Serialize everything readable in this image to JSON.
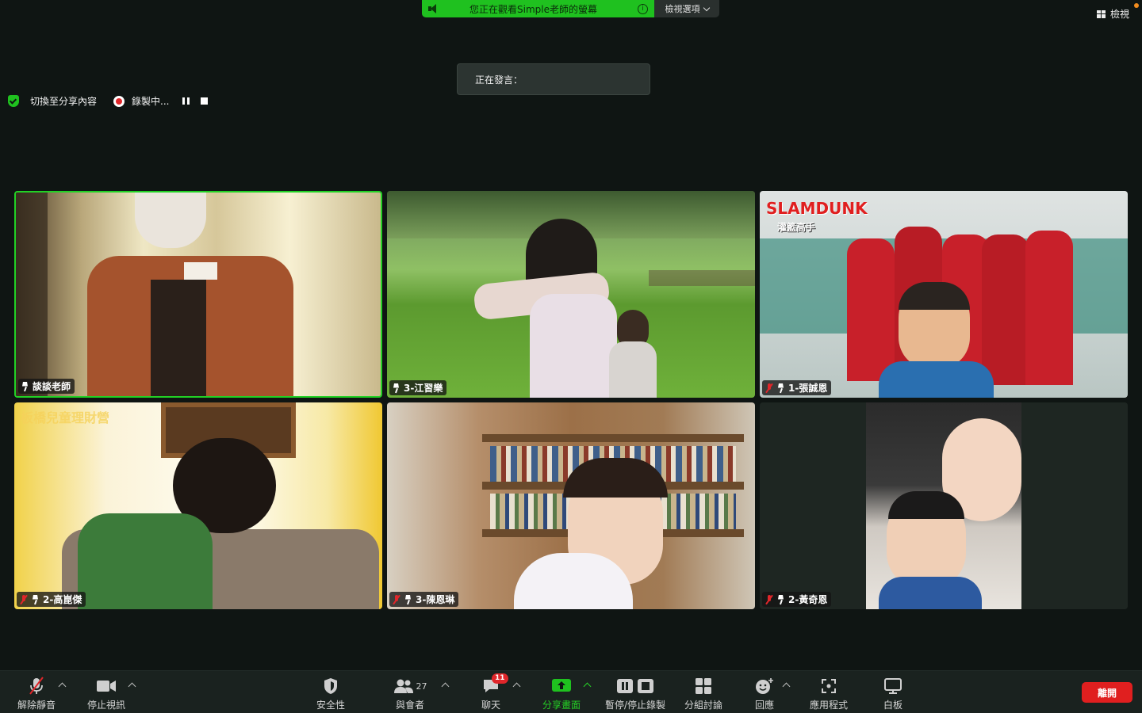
{
  "share_banner": {
    "text": "您正在觀看Simple老師的螢幕",
    "info": "i",
    "view_options": "檢視選項"
  },
  "top_right": {
    "view_label": "檢視"
  },
  "speaking": {
    "label": "正在發言："
  },
  "status_row": {
    "switch_label": "切換至分享內容",
    "recording_label": "錄製中..."
  },
  "participants": [
    {
      "name": "談談老師",
      "muted": false,
      "active": true
    },
    {
      "name": "3-江習樂",
      "muted": false,
      "active": false
    },
    {
      "name": "1-張誠恩",
      "muted": true,
      "active": false
    },
    {
      "name": "2-高崑傑",
      "muted": true,
      "active": false
    },
    {
      "name": "3-陳恩琳",
      "muted": true,
      "active": false
    },
    {
      "name": "2-黃奇恩",
      "muted": true,
      "active": false
    }
  ],
  "tile_text": {
    "slamdunk_logo": "SLAMDUNK",
    "slamdunk_sub": "灌籃高手",
    "banner_text": "板橋兒童理財營"
  },
  "toolbar": {
    "unmute": "解除靜音",
    "stop_video": "停止視訊",
    "security": "安全性",
    "participants": "與會者",
    "participants_count": "27",
    "chat": "聊天",
    "chat_badge": "11",
    "share": "分享畫面",
    "record": "暫停/停止錄製",
    "breakout": "分組討論",
    "reactions": "回應",
    "apps": "應用程式",
    "whiteboard": "白板",
    "leave": "離開"
  },
  "colors": {
    "accent_green": "#1fc11f",
    "leave_red": "#e01f1f",
    "badge_red": "#e0262a",
    "background": "#0f1513"
  }
}
